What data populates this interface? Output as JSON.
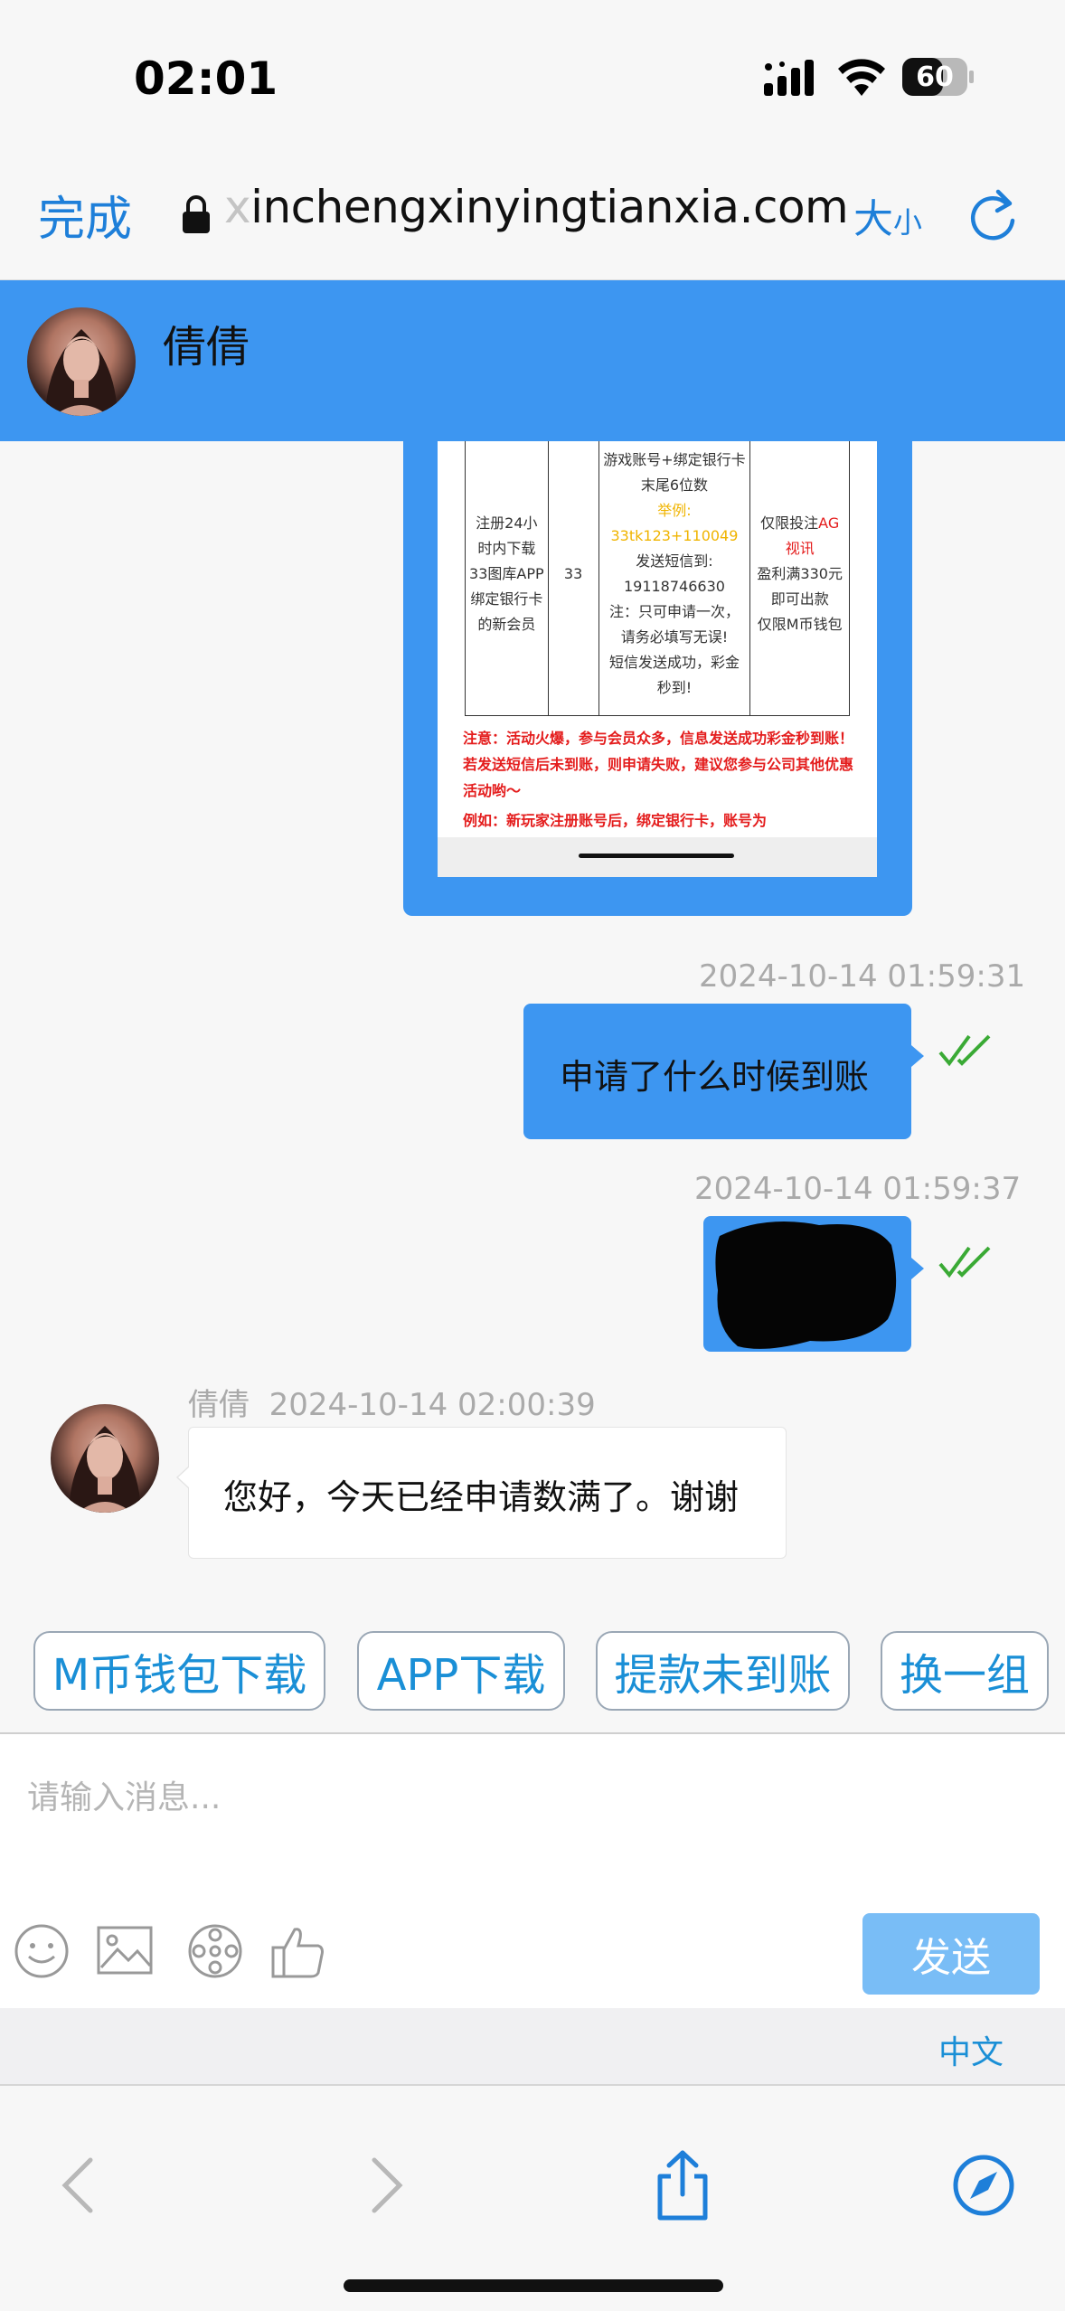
{
  "status_bar": {
    "time": "02:01",
    "battery": "60"
  },
  "browser": {
    "done_label": "完成",
    "url_faded": "x",
    "url": "inchengxinyingtianxia.com",
    "text_size_big": "大",
    "text_size_small": "小"
  },
  "chat_header": {
    "name": "倩倩"
  },
  "promo_image": {
    "row": {
      "col1": "注册24小时内下载33图库APP绑定银行卡的新会员",
      "col2": "33",
      "col3_line1": "游戏账号+绑定银行卡末尾6位数",
      "col3_example_label": "举例:",
      "col3_example_value": "33tk123+110049",
      "col3_line2": "发送短信到:",
      "col3_phone": "19118746630",
      "col3_line3": "注：只可申请一次，请务必填写无误!",
      "col3_line4": "短信发送成功，彩金秒到!",
      "col4_prefix": "仅限投注",
      "col4_red": "AG视讯",
      "col4_line2": "盈利满330元即可出款",
      "col4_line3": "仅限M币钱包"
    },
    "notice": "注意：活动火爆，参与会员众多，信息发送成功彩金秒到账！若发送短信后未到账，则申请失败，建议您参与公司其他优惠活动哟～",
    "example": "例如：新玩家注册账号后，绑定银行卡，账号为"
  },
  "messages": [
    {
      "timestamp": "2024-10-14 01:59:31",
      "text": "申请了什么时候到账"
    },
    {
      "timestamp": "2024-10-14 01:59:37"
    },
    {
      "sender": "倩倩",
      "timestamp": "2024-10-14 02:00:39",
      "text": "您好，今天已经申请数满了。谢谢"
    }
  ],
  "quick_replies": [
    "M币钱包下载",
    "APP下载",
    "提款未到账",
    "换一组"
  ],
  "input": {
    "placeholder": "请输入消息...",
    "value": ""
  },
  "send_label": "发送",
  "language_label": "中文",
  "colors": {
    "accent": "#3d96f1",
    "link": "#1a8fd6",
    "tick": "#3aaa35",
    "send_disabled": "#79bdf6"
  }
}
